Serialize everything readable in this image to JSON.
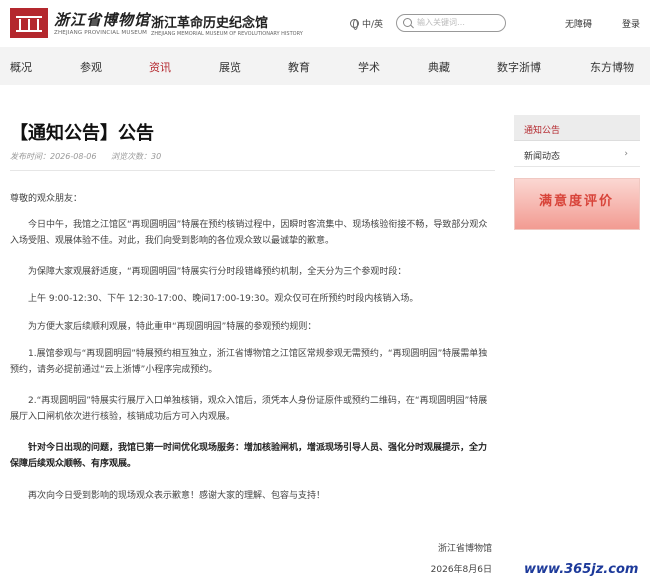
{
  "header": {
    "logo_cn": "浙江省博物馆",
    "logo_en": "ZHEJIANG PROVINCIAL MUSEUM",
    "logo2_cn": "浙江革命历史纪念馆",
    "logo2_en": "ZHEJIANG MEMORIAL MUSEUM OF REVOLUTIONARY HISTORY",
    "lang": "中/英",
    "search_placeholder": "输入关键词…",
    "accessibility": "无障碍",
    "login": "登录"
  },
  "nav": {
    "items": [
      "概况",
      "参观",
      "资讯",
      "展览",
      "教育",
      "学术",
      "典藏",
      "数字浙博",
      "东方博物"
    ],
    "active_index": 2
  },
  "article": {
    "title": "【通知公告】公告",
    "published": "发布时间：2026-08-06",
    "views": "浏览次数：30",
    "greeting": "尊敬的观众朋友：",
    "paragraphs": [
      "今日中午，我馆之江馆区“再现圆明园”特展在预约核销过程中，因瞬时客流集中、现场核验衔接不畅，导致部分观众入场受阻、观展体验不佳。对此，我们向受到影响的各位观众致以最诚挚的歉意。",
      "为保障大家观展舒适度，“再现圆明园”特展实行分时段错峰预约机制，全天分为三个参观时段：",
      "上午 9:00-12:30、下午 12:30-17:00、晚间17:00-19:30。观众仅可在所预约时段内核销入场。",
      "为方便大家后续顺利观展，特此重申“再现圆明园”特展的参观预约规则：",
      "1.展馆参观与“再现圆明园”特展预约相互独立，浙江省博物馆之江馆区常规参观无需预约，“再现圆明园”特展需单独预约，请务必提前通过“云上浙博”小程序完成预约。",
      "2.“再现圆明园”特展实行展厅入口单独核销，观众入馆后，须凭本人身份证原件或预约二维码，在“再现圆明园”特展展厅入口闸机依次进行核验，核销成功后方可入内观展。",
      "针对今日出现的问题，我馆已第一时间优化现场服务：增加核验闸机，增派现场引导人员、强化分时观展提示，全力保障后续观众顺畅、有序观展。",
      "再次向今日受到影响的现场观众表示歉意！感谢大家的理解、包容与支持！"
    ],
    "signature": "浙江省博物馆",
    "date": "2026年8月6日"
  },
  "sidebar": {
    "items": [
      {
        "label": "通知公告"
      },
      {
        "label": "新闻动态"
      }
    ],
    "banner": "满意度评价"
  },
  "watermark": "www.365jz.com",
  "colors": {
    "accent": "#b4282e",
    "nav_bg": "#f3f3f3"
  }
}
